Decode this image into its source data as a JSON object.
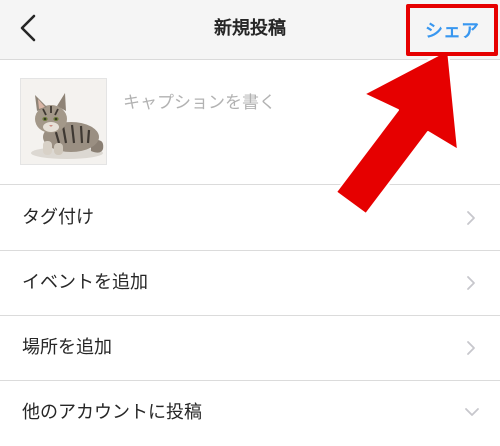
{
  "header": {
    "title": "新規投稿",
    "share_label": "シェア",
    "back_icon": "chevron-left-icon"
  },
  "caption": {
    "placeholder": "キャプションを書く",
    "value": ""
  },
  "thumbnail": {
    "subject": "tabby kitten photo"
  },
  "menu": {
    "items": [
      {
        "label": "タグ付け",
        "icon": "chevron-right-icon"
      },
      {
        "label": "イベントを追加",
        "icon": "chevron-right-icon"
      },
      {
        "label": "場所を追加",
        "icon": "chevron-right-icon"
      },
      {
        "label": "他のアカウントに投稿",
        "icon": "chevron-down-icon"
      }
    ]
  },
  "annotation": {
    "highlight_color": "#e60000",
    "arrow_icon": "arrow-up-right-icon"
  },
  "colors": {
    "accent": "#3897f0",
    "text": "#262626",
    "placeholder": "#b2b2b2",
    "divider": "#dbdbdb",
    "header_bg": "#f5f5f5"
  }
}
